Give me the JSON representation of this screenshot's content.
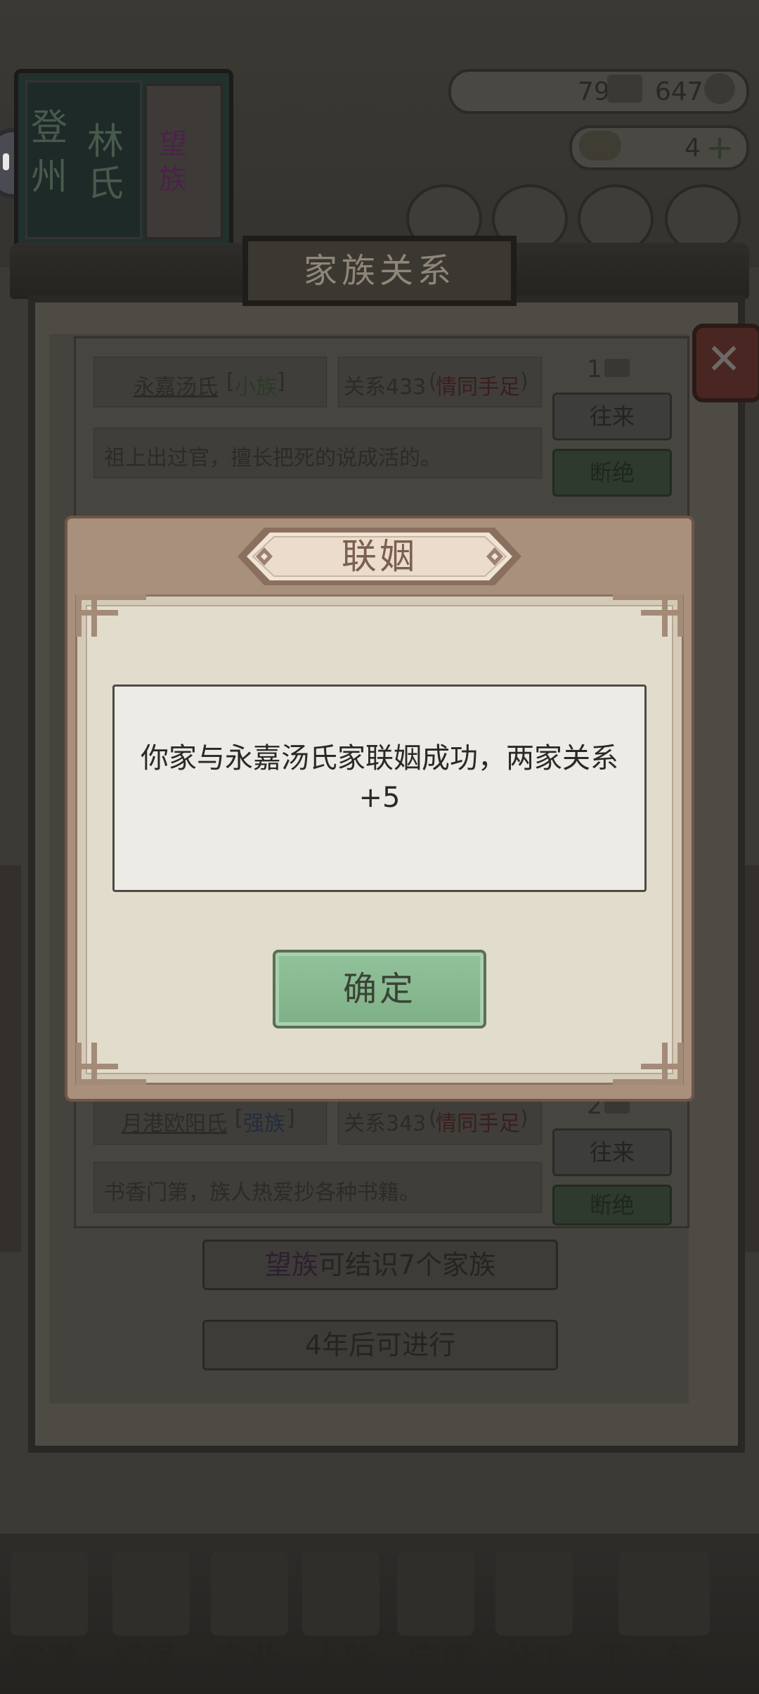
{
  "top_bar": {
    "book_title_1": "登",
    "book_title_2": "州",
    "book_title_3": "林",
    "book_title_4": "氏",
    "book_tag_1": "望",
    "book_tag_2": "族",
    "stat_1_value": "79",
    "stat_2_value": "647",
    "gold_value": "4"
  },
  "panel": {
    "title": "家族关系",
    "families": [
      {
        "name": "永嘉汤氏",
        "rank": "小族",
        "relation_label": "关系433",
        "relation_status": "情同手足",
        "count": "1",
        "desc": "祖上出过官，擅长把死的说成活的。",
        "btn_visit": "往来",
        "btn_break": "断绝"
      },
      {
        "name": "月港欧阳氏",
        "rank": "强族",
        "relation_label": "关系343",
        "relation_status": "情同手足",
        "count": "2",
        "desc": "书香门第，族人热爱抄各种书籍。",
        "btn_visit": "往来",
        "btn_break": "断绝"
      }
    ],
    "clan_info_highlight": "望族",
    "clan_info_rest": "可结识7个家族",
    "cooldown": "4年后可进行"
  },
  "bottom_nav": [
    "家谱",
    "成员",
    "产业",
    "人脉",
    "宝库",
    "分工",
    "下一年"
  ],
  "modal": {
    "title": "联姻",
    "message": "你家与永嘉汤氏家联姻成功，两家关系+5",
    "confirm_label": "确定"
  },
  "colors": {
    "modal_frame": "#a9907d",
    "modal_body": "#e2dccd",
    "confirm_green": "#85b68e",
    "status_red": "#c0392b",
    "rank_green": "#6aa84f",
    "rank_blue": "#5b8fd6",
    "clan_purple": "#8e5a9e"
  }
}
